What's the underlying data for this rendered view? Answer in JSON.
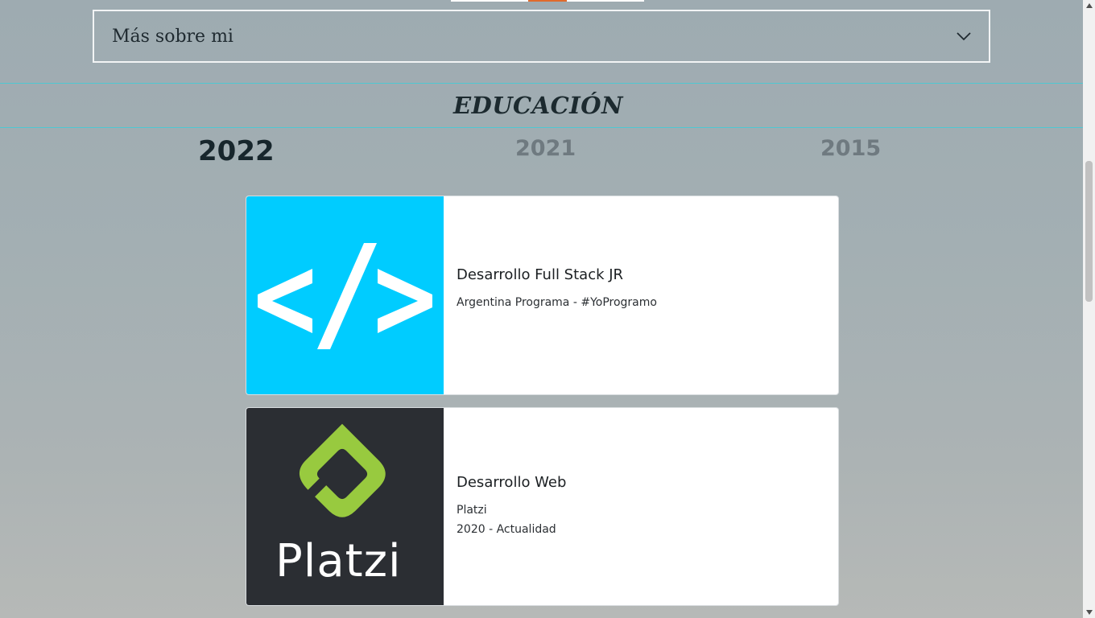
{
  "accordion": {
    "label": "Más sobre mi",
    "icon": "chevron-down-icon"
  },
  "section": {
    "title": "EDUCACIÓN"
  },
  "years": {
    "active": "2022",
    "others": [
      "2021",
      "2015"
    ]
  },
  "cards": [
    {
      "title": "Desarrollo Full Stack JR",
      "lines": [
        "Argentina Programa - #YoProgramo"
      ],
      "image": "code-brackets-logo",
      "image_color": "#00ccff"
    },
    {
      "title": "Desarrollo Web",
      "lines": [
        "Platzi",
        "2020 - Actualidad"
      ],
      "image": "platzi-logo",
      "logo_text": "Platzi",
      "image_color": "#2b2e33",
      "logo_accent": "#98ca3f"
    }
  ],
  "colors": {
    "section_border": "#4fc7d2",
    "top_accent": "#e06a2c"
  }
}
